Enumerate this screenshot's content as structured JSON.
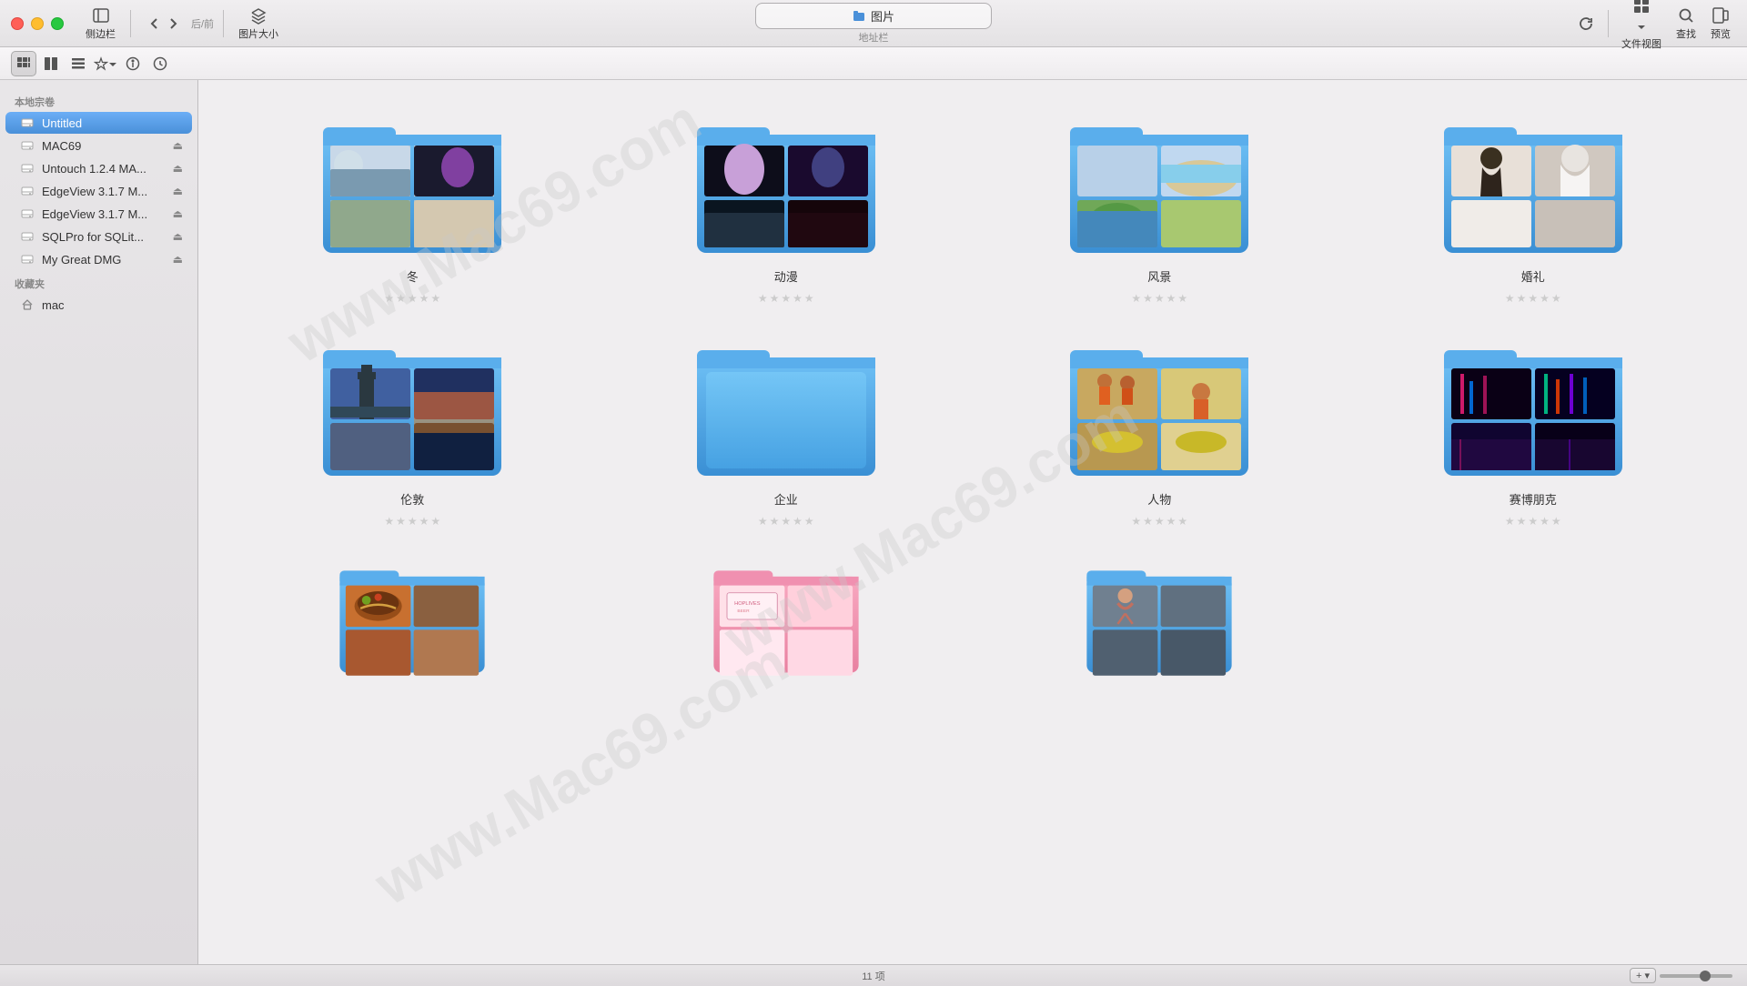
{
  "titlebar": {
    "address": "图片",
    "address_sub": "地址栏",
    "refresh_label": "刷新",
    "sidebar_label": "侧边栏",
    "nav_label": "后/前",
    "size_label": "图片大小",
    "view_label": "文件视图",
    "search_label": "查找",
    "preview_label": "预览"
  },
  "sidebar": {
    "local_section": "本地宗卷",
    "favorites_section": "收藏夹",
    "items": [
      {
        "id": "untitled",
        "label": "Untitled",
        "active": true,
        "eject": false,
        "icon": "drive"
      },
      {
        "id": "mac69",
        "label": "MAC69",
        "active": false,
        "eject": true,
        "icon": "drive"
      },
      {
        "id": "untouch",
        "label": "Untouch 1.2.4 MA...",
        "active": false,
        "eject": true,
        "icon": "drive"
      },
      {
        "id": "edgeview1",
        "label": "EdgeView 3.1.7 M...",
        "active": false,
        "eject": true,
        "icon": "drive"
      },
      {
        "id": "edgeview2",
        "label": "EdgeView 3.1.7 M...",
        "active": false,
        "eject": true,
        "icon": "drive"
      },
      {
        "id": "sqlpro",
        "label": "SQLPro for SQLit...",
        "active": false,
        "eject": true,
        "icon": "drive"
      },
      {
        "id": "dmg",
        "label": "My Great DMG",
        "active": false,
        "eject": true,
        "icon": "drive"
      }
    ],
    "favorites": [
      {
        "id": "mac",
        "label": "mac",
        "icon": "home"
      }
    ]
  },
  "folders": [
    {
      "id": "dong",
      "name": "冬",
      "stars": 0,
      "has_images": true,
      "color": "#4fa3e0",
      "img_count": 4
    },
    {
      "id": "dongman",
      "name": "动漫",
      "stars": 0,
      "has_images": true,
      "color": "#4fa3e0",
      "img_count": 4
    },
    {
      "id": "fengjing",
      "name": "风景",
      "stars": 0,
      "has_images": true,
      "color": "#4fa3e0",
      "img_count": 4
    },
    {
      "id": "hunli",
      "name": "婚礼",
      "stars": 0,
      "has_images": true,
      "color": "#4fa3e0",
      "img_count": 4
    },
    {
      "id": "lundun",
      "name": "伦敦",
      "stars": 0,
      "has_images": true,
      "color": "#4fa3e0",
      "img_count": 4
    },
    {
      "id": "qiye",
      "name": "企业",
      "stars": 0,
      "has_images": false,
      "color": "#4fa3e0",
      "img_count": 0
    },
    {
      "id": "renwu",
      "name": "人物",
      "stars": 0,
      "has_images": true,
      "color": "#4fa3e0",
      "img_count": 4
    },
    {
      "id": "saibopengke",
      "name": "赛博朋克",
      "stars": 0,
      "has_images": true,
      "color": "#4fa3e0",
      "img_count": 4
    },
    {
      "id": "food",
      "name": "",
      "stars": 0,
      "has_images": true,
      "color": "#4fa3e0",
      "partial": true
    },
    {
      "id": "pink",
      "name": "",
      "stars": 0,
      "has_images": true,
      "color": "#f48fb1",
      "partial": true
    },
    {
      "id": "fitness",
      "name": "",
      "stars": 0,
      "has_images": true,
      "color": "#4fa3e0",
      "partial": true
    }
  ],
  "statusbar": {
    "count": "11 项"
  },
  "toolbar2_icons": [
    "grid4",
    "grid2",
    "list",
    "star-filter",
    "info",
    "clock"
  ],
  "watermark": "www.Mac69.com"
}
